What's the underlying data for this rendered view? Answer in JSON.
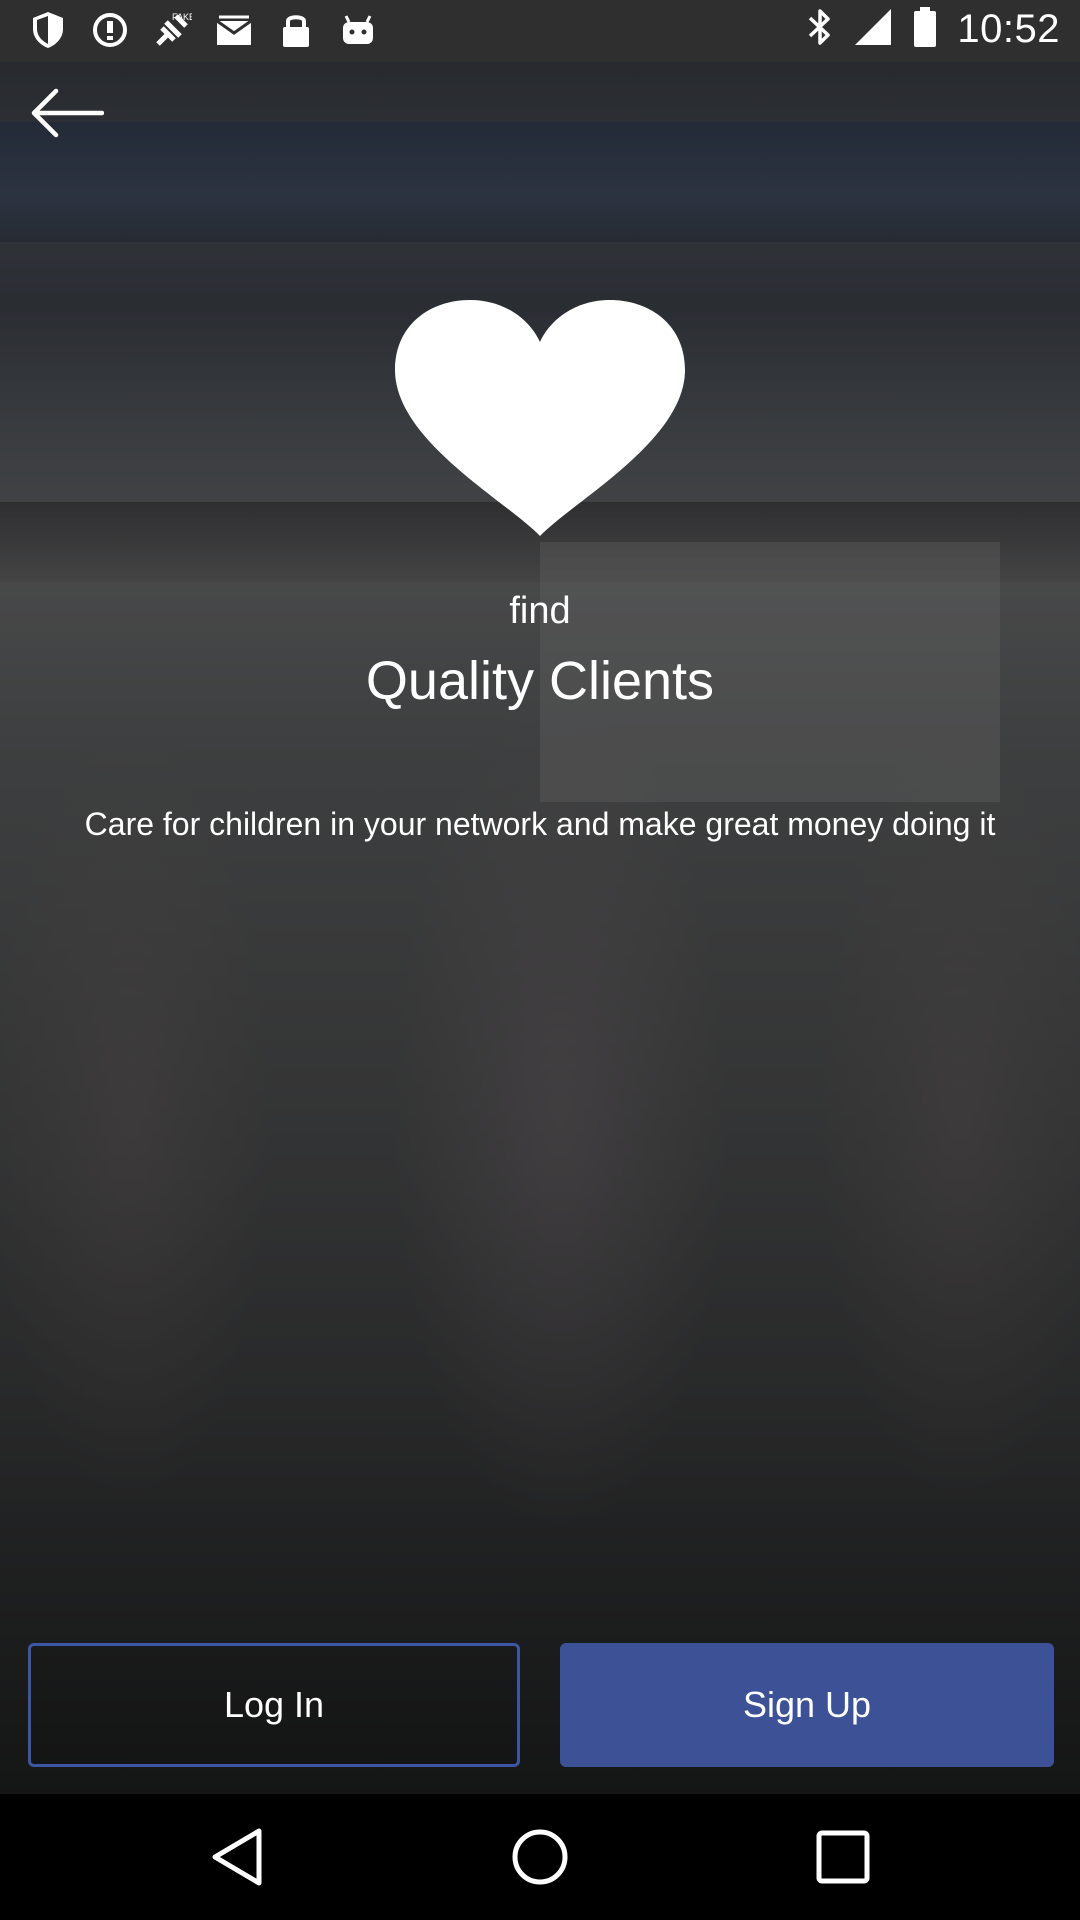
{
  "status_bar": {
    "time": "10:52",
    "left_icons": [
      "shield-icon",
      "info-icon",
      "fake-gps-icon",
      "mail-icon",
      "lock-icon",
      "android-icon"
    ],
    "right_icons": [
      "bluetooth-icon"
    ]
  },
  "header": {
    "back_icon": "back-arrow-icon"
  },
  "hero": {
    "icon": "heart-icon",
    "find_label": "find",
    "headline": "Quality Clients",
    "subtitle": "Care for children in your network and make great money doing it"
  },
  "actions": {
    "login_label": "Log In",
    "signup_label": "Sign Up",
    "login_border_color": "#3d56a3",
    "signup_bg_color": "#3d5196"
  },
  "nav_bar": {
    "items": [
      "back-nav-icon",
      "home-nav-icon",
      "recents-nav-icon"
    ]
  }
}
